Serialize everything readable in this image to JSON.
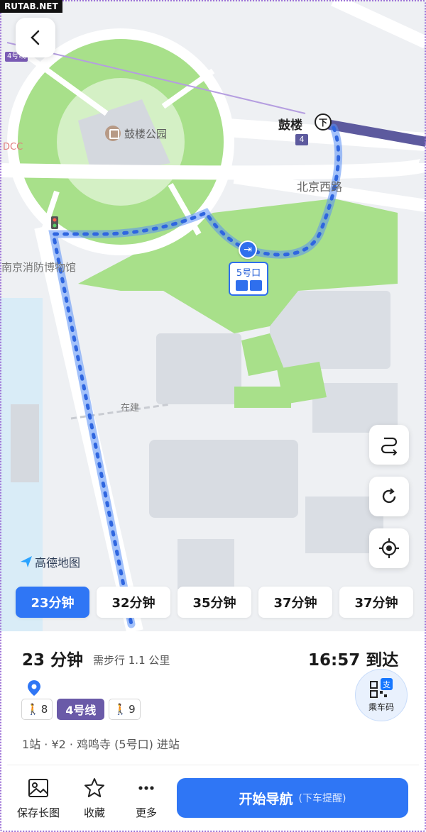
{
  "watermark": "RUTAB.NET",
  "map": {
    "park_label": "鼓楼公园",
    "station_label": "鼓楼",
    "station_icon_text": "下",
    "line_badge": "4",
    "line_badge_small": "4号线",
    "road_label": "北京西路",
    "museum_label": "南京消防博物馆",
    "left_edge_label": "DCC",
    "construction_label": "在建",
    "exit_label": "5号口",
    "logo_text": "高德地图"
  },
  "controls": {
    "back_icon": "chevron-left-icon",
    "side_buttons": [
      "route-switch-icon",
      "refresh-icon",
      "locate-icon"
    ]
  },
  "route_options": [
    {
      "label": "23分钟",
      "active": true
    },
    {
      "label": "32分钟",
      "active": false
    },
    {
      "label": "35分钟",
      "active": false
    },
    {
      "label": "37分钟",
      "active": false
    },
    {
      "label": "37分钟",
      "active": false
    }
  ],
  "summary": {
    "duration": "23 分钟",
    "walk": "需步行 1.1 公里",
    "arrival": "16:57 到达",
    "walk_before": "8",
    "line": "4号线",
    "walk_after": "9",
    "info": "1站 · ¥2 · 鸡鸣寺 (5号口) 进站",
    "qr_label": "乘车码",
    "qr_badge": "支"
  },
  "actions": {
    "save": "保存长图",
    "favorite": "收藏",
    "more": "更多",
    "start": "开始导航",
    "start_sub": "(下车提醒)"
  },
  "colors": {
    "route_blue": "#2f76f5",
    "park_green": "#a8e08a",
    "metro_purple": "#5d5a9e"
  }
}
